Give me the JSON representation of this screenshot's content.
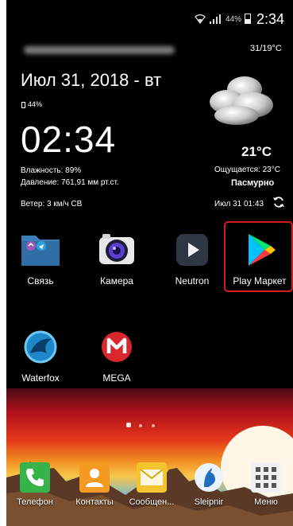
{
  "status_bar": {
    "battery_percent": "44%",
    "time": "2:34"
  },
  "weather": {
    "temp_range": "31/19°C",
    "date": "Июл 31, 2018 - вт",
    "battery": "44%",
    "time": "02:34",
    "temperature": "21°C",
    "feels_like": "Ощущается: 23°C",
    "condition": "Пасмурно",
    "humidity": "Влажность: 89%",
    "pressure": "Давление: 761,91 мм рт.ст.",
    "wind": "Ветер: 3 км/ч СВ",
    "updated": "Июл 31  01:43"
  },
  "apps": [
    {
      "label": "Связь",
      "icon": "folder-icon"
    },
    {
      "label": "Камера",
      "icon": "camera-icon"
    },
    {
      "label": "Neutron",
      "icon": "neutron-play-icon"
    },
    {
      "label": "Play Маркет",
      "icon": "play-store-icon"
    },
    {
      "label": "Waterfox",
      "icon": "waterfox-icon"
    },
    {
      "label": "MEGA",
      "icon": "mega-icon"
    }
  ],
  "dock": [
    {
      "label": "Телефон",
      "icon": "phone-icon"
    },
    {
      "label": "Контакты",
      "icon": "contacts-icon"
    },
    {
      "label": "Сообщен...",
      "icon": "messages-icon"
    },
    {
      "label": "Sleipnir",
      "icon": "sleipnir-icon"
    },
    {
      "label": "Меню",
      "icon": "apps-menu-icon"
    }
  ],
  "colors": {
    "highlight": "#d11d1d",
    "background": "#000000"
  }
}
